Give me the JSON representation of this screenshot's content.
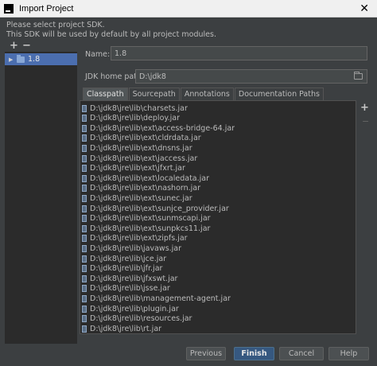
{
  "window": {
    "title": "Import Project",
    "close_glyph": "✕"
  },
  "message": {
    "line1": "Please select project SDK.",
    "line2": "This SDK will be used by default by all project modules."
  },
  "toolbar": {
    "add_glyph": "+",
    "remove_glyph": "−"
  },
  "sdk_list": {
    "items": [
      {
        "label": "1.8",
        "icon": "folder-icon",
        "selected": true
      }
    ]
  },
  "form": {
    "name_label": "Name:",
    "name_value": "1.8",
    "jdk_home_label": "JDK home path:",
    "jdk_home_value": "D:\\jdk8"
  },
  "tabs": [
    {
      "label": "Classpath",
      "active": true
    },
    {
      "label": "Sourcepath",
      "active": false
    },
    {
      "label": "Annotations",
      "active": false
    },
    {
      "label": "Documentation Paths",
      "active": false
    }
  ],
  "classpath": [
    "D:\\jdk8\\jre\\lib\\charsets.jar",
    "D:\\jdk8\\jre\\lib\\deploy.jar",
    "D:\\jdk8\\jre\\lib\\ext\\access-bridge-64.jar",
    "D:\\jdk8\\jre\\lib\\ext\\cldrdata.jar",
    "D:\\jdk8\\jre\\lib\\ext\\dnsns.jar",
    "D:\\jdk8\\jre\\lib\\ext\\jaccess.jar",
    "D:\\jdk8\\jre\\lib\\ext\\jfxrt.jar",
    "D:\\jdk8\\jre\\lib\\ext\\localedata.jar",
    "D:\\jdk8\\jre\\lib\\ext\\nashorn.jar",
    "D:\\jdk8\\jre\\lib\\ext\\sunec.jar",
    "D:\\jdk8\\jre\\lib\\ext\\sunjce_provider.jar",
    "D:\\jdk8\\jre\\lib\\ext\\sunmscapi.jar",
    "D:\\jdk8\\jre\\lib\\ext\\sunpkcs11.jar",
    "D:\\jdk8\\jre\\lib\\ext\\zipfs.jar",
    "D:\\jdk8\\jre\\lib\\javaws.jar",
    "D:\\jdk8\\jre\\lib\\jce.jar",
    "D:\\jdk8\\jre\\lib\\jfr.jar",
    "D:\\jdk8\\jre\\lib\\jfxswt.jar",
    "D:\\jdk8\\jre\\lib\\jsse.jar",
    "D:\\jdk8\\jre\\lib\\management-agent.jar",
    "D:\\jdk8\\jre\\lib\\plugin.jar",
    "D:\\jdk8\\jre\\lib\\resources.jar",
    "D:\\jdk8\\jre\\lib\\rt.jar"
  ],
  "side_toolbar": {
    "add_glyph": "+",
    "remove_glyph": "−"
  },
  "buttons": {
    "previous": "Previous",
    "finish": "Finish",
    "cancel": "Cancel",
    "help": "Help"
  },
  "colors": {
    "background": "#3c3f41",
    "list_background": "#2b2b2b",
    "selection": "#4b6eaf",
    "default_button": "#365880"
  }
}
